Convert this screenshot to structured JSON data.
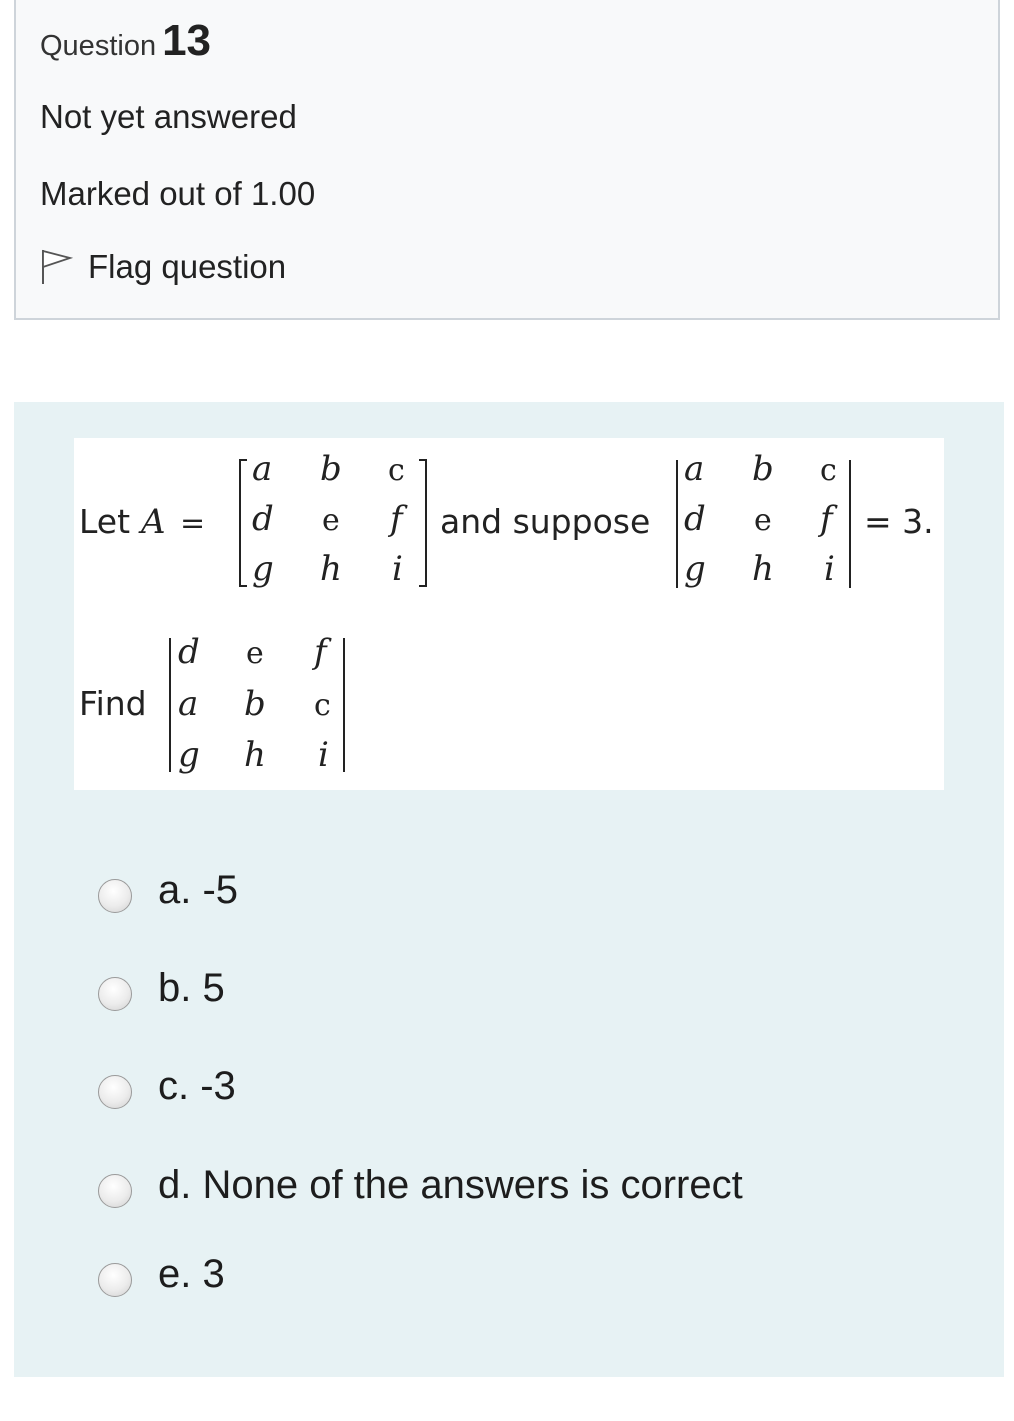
{
  "info": {
    "question_label": "Question",
    "question_number": "13",
    "state": "Not yet answered",
    "grade": "Marked out of 1.00",
    "flag_label": "Flag question"
  },
  "question": {
    "let_text": "Let",
    "var_A": "A",
    "equals": "=",
    "and_suppose": "and suppose",
    "equals_3": "= 3.",
    "find": "Find",
    "matrix_A": [
      [
        "a",
        "b",
        "c"
      ],
      [
        "d",
        "e",
        "f"
      ],
      [
        "g",
        "h",
        "i"
      ]
    ],
    "matrix_find": [
      [
        "d",
        "e",
        "f"
      ],
      [
        "a",
        "b",
        "c"
      ],
      [
        "g",
        "h",
        "i"
      ]
    ]
  },
  "options": [
    {
      "label": "a. -5"
    },
    {
      "label": "b. 5"
    },
    {
      "label": "c. -3"
    },
    {
      "label": "d. None of the answers is correct"
    },
    {
      "label": "e. 3"
    }
  ],
  "colors": {
    "info_bg": "#f8f9fa",
    "content_bg": "#e7f2f4",
    "border": "#ced4da"
  },
  "icons": [
    "flag-icon"
  ]
}
